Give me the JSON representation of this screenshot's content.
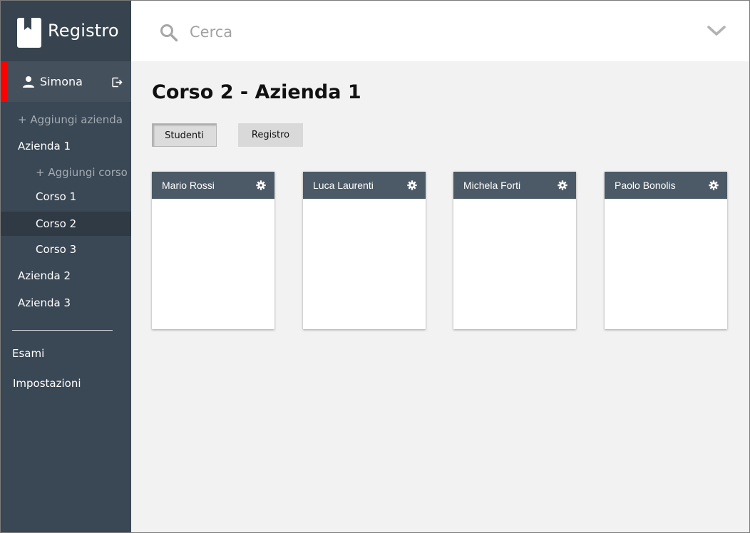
{
  "app": {
    "title": "Registro"
  },
  "user": {
    "name": "Simona"
  },
  "sidebar": {
    "add_company": "+ Aggiungi azienda",
    "companies": [
      {
        "label": "Azienda 1"
      },
      {
        "label": "Azienda 2"
      },
      {
        "label": "Azienda 3"
      }
    ],
    "add_course": "+ Aggiungi corso",
    "courses": [
      {
        "label": "Corso 1"
      },
      {
        "label": "Corso 2",
        "active": true
      },
      {
        "label": "Corso 3"
      }
    ],
    "links": [
      {
        "label": "Esami"
      },
      {
        "label": "Impostazioni"
      }
    ]
  },
  "search": {
    "placeholder": "Cerca"
  },
  "page": {
    "title": "Corso 2 - Azienda 1"
  },
  "tabs": [
    {
      "label": "Studenti",
      "active": true
    },
    {
      "label": "Registro"
    }
  ],
  "students": [
    {
      "name": "Mario Rossi"
    },
    {
      "name": "Luca Laurenti"
    },
    {
      "name": "Michela Forti"
    },
    {
      "name": "Paolo Bonolis"
    }
  ],
  "colors": {
    "sidebar": "#3a4754",
    "accent": "#ff0000",
    "card_header": "#4b5a66"
  },
  "icons": [
    "book-icon",
    "user-icon",
    "logout-icon",
    "search-icon",
    "chevron-down-icon",
    "gear-icon"
  ]
}
